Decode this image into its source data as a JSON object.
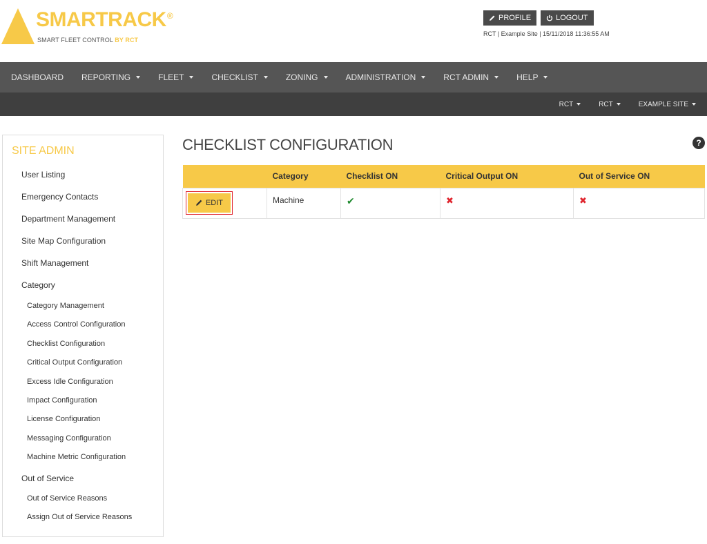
{
  "brand": {
    "name": "SMARTRACK",
    "reg_mark": "®",
    "tagline": "SMART FLEET CONTROL",
    "tagline_by": "BY RCT",
    "color": "#f7c948"
  },
  "header": {
    "profile_label": "PROFILE",
    "logout_label": "LOGOUT",
    "info": "RCT | Example Site | 15/11/2018 11:36:55 AM"
  },
  "nav": {
    "items": [
      {
        "label": "DASHBOARD",
        "caret": false
      },
      {
        "label": "REPORTING",
        "caret": true
      },
      {
        "label": "FLEET",
        "caret": true
      },
      {
        "label": "CHECKLIST",
        "caret": true
      },
      {
        "label": "ZONING",
        "caret": true
      },
      {
        "label": "ADMINISTRATION",
        "caret": true
      },
      {
        "label": "RCT ADMIN",
        "caret": true
      },
      {
        "label": "HELP",
        "caret": true
      }
    ],
    "context": [
      "RCT",
      "RCT",
      "EXAMPLE SITE"
    ]
  },
  "sidebar": {
    "title": "SITE ADMIN",
    "items": [
      {
        "label": "User Listing",
        "level": 1
      },
      {
        "label": "Emergency Contacts",
        "level": 1
      },
      {
        "label": "Department Management",
        "level": 1
      },
      {
        "label": "Site Map Configuration",
        "level": 1
      },
      {
        "label": "Shift Management",
        "level": 1
      },
      {
        "label": "Category",
        "level": 1
      },
      {
        "label": "Category Management",
        "level": 2
      },
      {
        "label": "Access Control Configuration",
        "level": 2
      },
      {
        "label": "Checklist Configuration",
        "level": 2
      },
      {
        "label": "Critical Output Configuration",
        "level": 2
      },
      {
        "label": "Excess Idle Configuration",
        "level": 2
      },
      {
        "label": "Impact Configuration",
        "level": 2
      },
      {
        "label": "License Configuration",
        "level": 2
      },
      {
        "label": "Messaging Configuration",
        "level": 2
      },
      {
        "label": "Machine Metric Configuration",
        "level": 2
      },
      {
        "label": "Out of Service",
        "level": 1
      },
      {
        "label": "Out of Service Reasons",
        "level": 2
      },
      {
        "label": "Assign Out of Service Reasons",
        "level": 2
      }
    ]
  },
  "main": {
    "title": "CHECKLIST CONFIGURATION",
    "help_icon": "?",
    "table": {
      "headers": [
        "",
        "Category",
        "Checklist ON",
        "Critical Output ON",
        "Out of Service ON"
      ],
      "rows": [
        {
          "edit_label": "EDIT",
          "category": "Machine",
          "checklist_on": "✔",
          "critical_output_on": "✖",
          "out_of_service_on": "✖"
        }
      ]
    }
  }
}
